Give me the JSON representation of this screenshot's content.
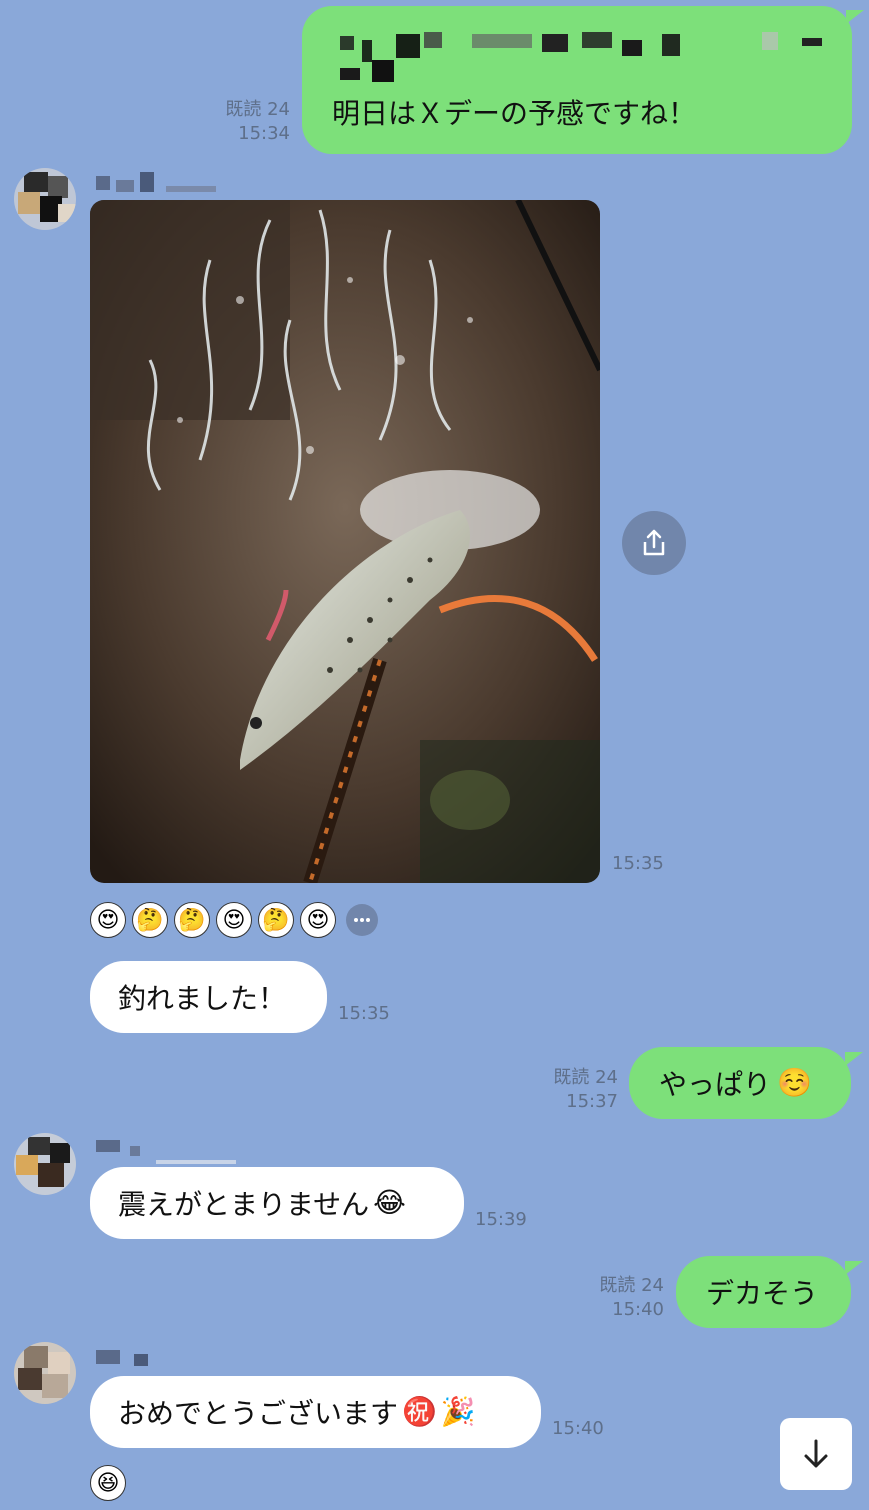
{
  "messages": {
    "m1": {
      "text": "明日はＸデーの予感ですね！",
      "read": "既読 24",
      "time": "15:34"
    },
    "photo": {
      "time": "15:35",
      "reactions": [
        "😍",
        "🤔",
        "🤔",
        "😍",
        "🤔",
        "😍"
      ]
    },
    "m2": {
      "text": "釣れました！",
      "time": "15:35"
    },
    "m3": {
      "text": "やっぱり",
      "emoji": "☺️",
      "read": "既読 24",
      "time": "15:37"
    },
    "m4": {
      "text": "震えがとまりません",
      "emoji": "😂",
      "time": "15:39"
    },
    "m5": {
      "text": "デカそう",
      "read": "既読 24",
      "time": "15:40"
    },
    "m6": {
      "text": "おめでとうございます",
      "emoji1": "㊗️",
      "emoji2": "🎉",
      "time": "15:40"
    },
    "last_reaction": "😆"
  },
  "icons": {
    "share": "share-icon",
    "scroll": "arrow-down-icon",
    "more": "more-icon"
  },
  "colors": {
    "background": "#8aa8d9",
    "outgoing": "#7de07a",
    "incoming": "#ffffff"
  }
}
